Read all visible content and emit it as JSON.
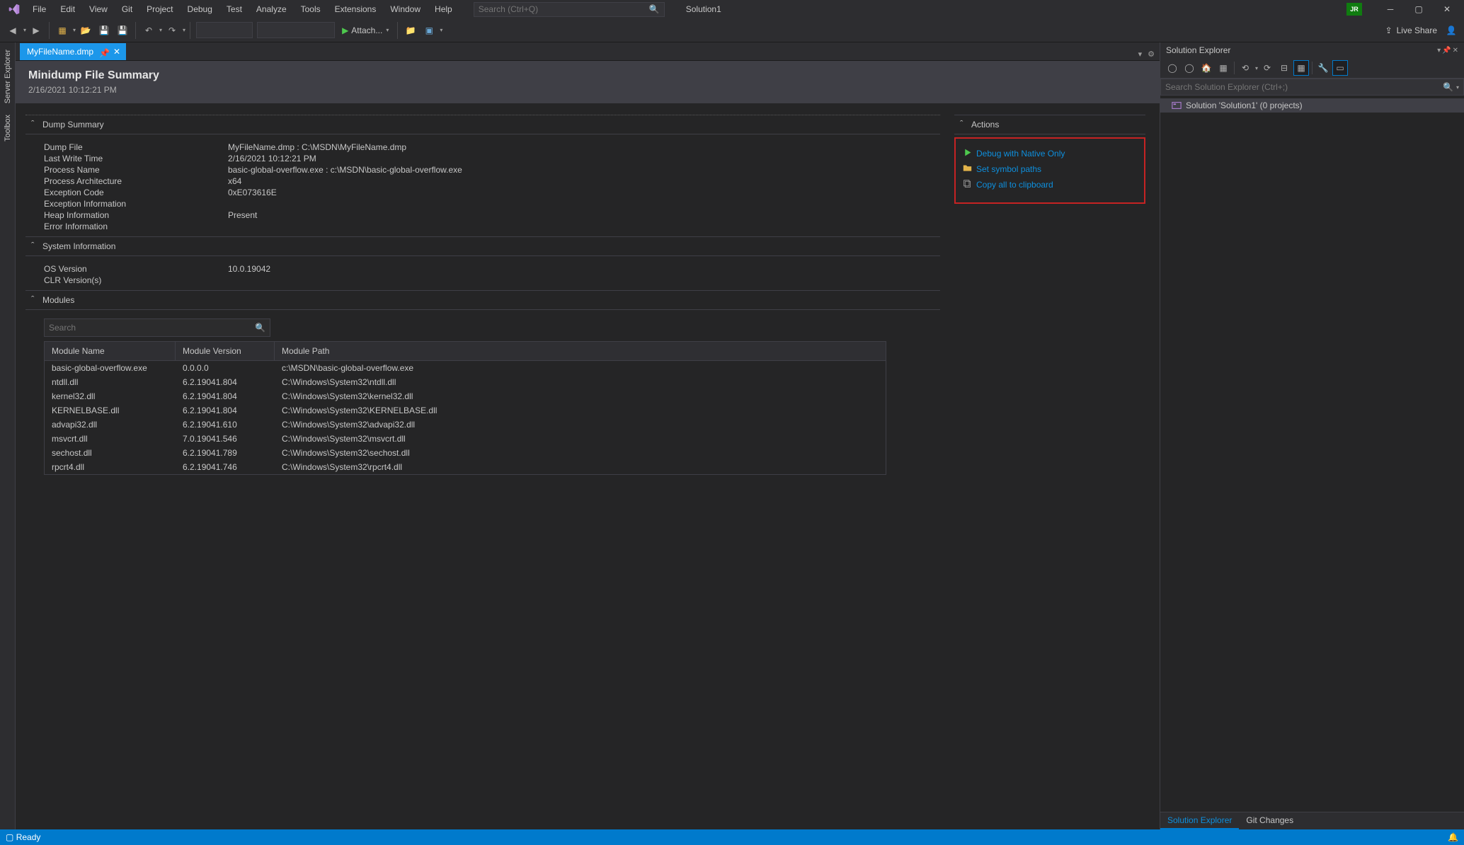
{
  "menu": [
    "File",
    "Edit",
    "View",
    "Git",
    "Project",
    "Debug",
    "Test",
    "Analyze",
    "Tools",
    "Extensions",
    "Window",
    "Help"
  ],
  "search": {
    "placeholder": "Search (Ctrl+Q)"
  },
  "solution_name": "Solution1",
  "user_badge": "JR",
  "attach_label": "Attach...",
  "live_share": "Live Share",
  "doc_tab": {
    "title": "MyFileName.dmp"
  },
  "left_rail": [
    "Server Explorer",
    "Toolbox"
  ],
  "dump": {
    "title": "Minidump File Summary",
    "timestamp": "2/16/2021 10:12:21 PM",
    "summary_title": "Dump Summary",
    "rows": [
      {
        "k": "Dump File",
        "v": "MyFileName.dmp : C:\\MSDN\\MyFileName.dmp"
      },
      {
        "k": "Last Write Time",
        "v": "2/16/2021 10:12:21 PM"
      },
      {
        "k": "Process Name",
        "v": "basic-global-overflow.exe : c:\\MSDN\\basic-global-overflow.exe"
      },
      {
        "k": "Process Architecture",
        "v": "x64"
      },
      {
        "k": "Exception Code",
        "v": "0xE073616E"
      },
      {
        "k": "Exception Information",
        "v": ""
      },
      {
        "k": "Heap Information",
        "v": "Present"
      },
      {
        "k": "Error Information",
        "v": ""
      }
    ],
    "sysinfo_title": "System Information",
    "sys_rows": [
      {
        "k": "OS Version",
        "v": "10.0.19042"
      },
      {
        "k": "CLR Version(s)",
        "v": ""
      }
    ],
    "modules_title": "Modules",
    "mod_search_placeholder": "Search",
    "mod_cols": [
      "Module Name",
      "Module Version",
      "Module Path"
    ],
    "modules": [
      {
        "n": "basic-global-overflow.exe",
        "v": "0.0.0.0",
        "p": "c:\\MSDN\\basic-global-overflow.exe"
      },
      {
        "n": "ntdll.dll",
        "v": "6.2.19041.804",
        "p": "C:\\Windows\\System32\\ntdll.dll"
      },
      {
        "n": "kernel32.dll",
        "v": "6.2.19041.804",
        "p": "C:\\Windows\\System32\\kernel32.dll"
      },
      {
        "n": "KERNELBASE.dll",
        "v": "6.2.19041.804",
        "p": "C:\\Windows\\System32\\KERNELBASE.dll"
      },
      {
        "n": "advapi32.dll",
        "v": "6.2.19041.610",
        "p": "C:\\Windows\\System32\\advapi32.dll"
      },
      {
        "n": "msvcrt.dll",
        "v": "7.0.19041.546",
        "p": "C:\\Windows\\System32\\msvcrt.dll"
      },
      {
        "n": "sechost.dll",
        "v": "6.2.19041.789",
        "p": "C:\\Windows\\System32\\sechost.dll"
      },
      {
        "n": "rpcrt4.dll",
        "v": "6.2.19041.746",
        "p": "C:\\Windows\\System32\\rpcrt4.dll"
      }
    ],
    "actions_title": "Actions",
    "actions": [
      {
        "label": "Debug with Native Only",
        "icon": "play"
      },
      {
        "label": "Set symbol paths",
        "icon": "folder"
      },
      {
        "label": "Copy all to clipboard",
        "icon": "copy"
      }
    ]
  },
  "se": {
    "title": "Solution Explorer",
    "search_placeholder": "Search Solution Explorer (Ctrl+;)",
    "root": "Solution 'Solution1' (0 projects)",
    "tabs": [
      "Solution Explorer",
      "Git Changes"
    ]
  },
  "status": {
    "text": "Ready"
  }
}
